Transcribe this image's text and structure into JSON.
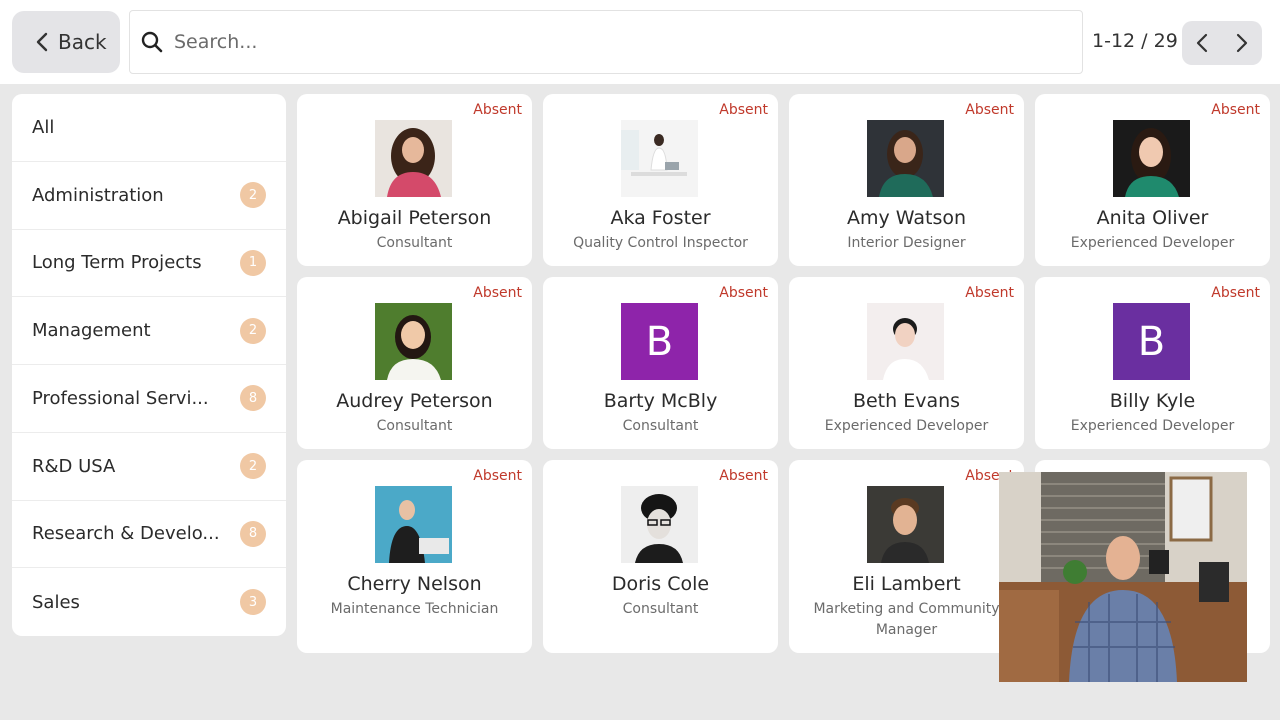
{
  "topbar": {
    "back_label": "Back",
    "search_placeholder": "Search...",
    "pager_text": "1-12 / 29"
  },
  "sidebar": {
    "items": [
      {
        "label": "All",
        "count": ""
      },
      {
        "label": "Administration",
        "count": "2"
      },
      {
        "label": "Long Term Projects",
        "count": "1"
      },
      {
        "label": "Management",
        "count": "2"
      },
      {
        "label": "Professional Servi...",
        "count": "8"
      },
      {
        "label": "R&D USA",
        "count": "2"
      },
      {
        "label": "Research & Develo...",
        "count": "8"
      },
      {
        "label": "Sales",
        "count": "3"
      }
    ]
  },
  "employees": [
    {
      "name": "Abigail Peterson",
      "job": "Consultant",
      "status": "Absent"
    },
    {
      "name": "Aka Foster",
      "job": "Quality Control Inspector",
      "status": "Absent"
    },
    {
      "name": "Amy Watson",
      "job": "Interior Designer",
      "status": "Absent"
    },
    {
      "name": "Anita Oliver",
      "job": "Experienced Developer",
      "status": "Absent"
    },
    {
      "name": "Audrey Peterson",
      "job": "Consultant",
      "status": "Absent"
    },
    {
      "name": "Barty McBly",
      "job": "Consultant",
      "status": "Absent",
      "initial": "B"
    },
    {
      "name": "Beth Evans",
      "job": "Experienced Developer",
      "status": "Absent"
    },
    {
      "name": "Billy Kyle",
      "job": "Experienced Developer",
      "status": "Absent",
      "initial": "B"
    },
    {
      "name": "Cherry Nelson",
      "job": "Maintenance Technician",
      "status": "Absent"
    },
    {
      "name": "Doris Cole",
      "job": "Consultant",
      "status": "Absent"
    },
    {
      "name": "Eli Lambert",
      "job": "Marketing and Community Manager",
      "status": "Absent"
    }
  ],
  "colors": {
    "absent": "#c0392b",
    "badge": "#f0c8a4",
    "monogram_barty": "#8e24aa",
    "monogram_billy": "#6a2fa0"
  }
}
